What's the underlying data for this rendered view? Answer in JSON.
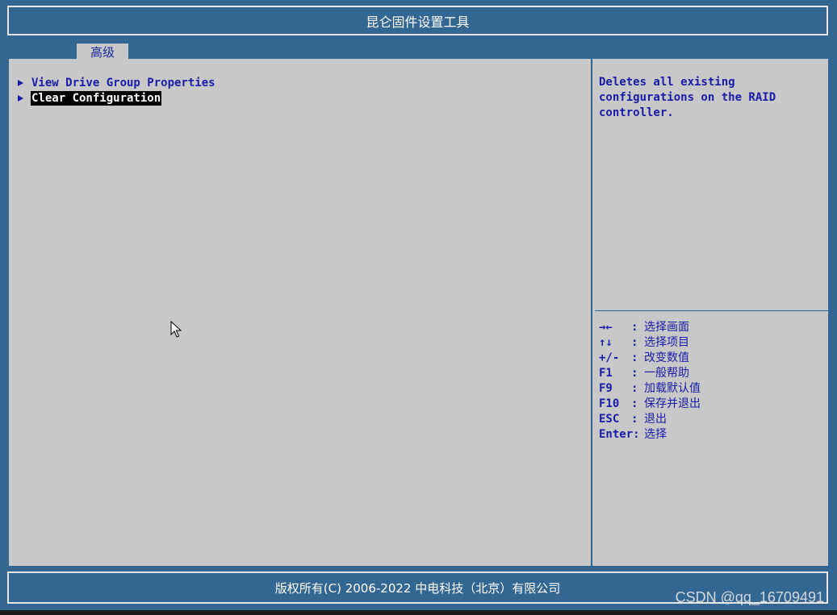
{
  "window": {
    "title": "昆仑固件设置工具"
  },
  "tabs": [
    {
      "label": "高级",
      "active": true
    }
  ],
  "menu": {
    "items": [
      {
        "label": "View Drive Group Properties",
        "selected": false
      },
      {
        "label": "Clear Configuration",
        "selected": true
      }
    ]
  },
  "help": {
    "text": "Deletes all existing\nconfigurations on the RAID\ncontroller."
  },
  "keys": [
    {
      "key": "→←",
      "sep": ":",
      "desc": "选择画面"
    },
    {
      "key": "↑↓",
      "sep": ":",
      "desc": "选择项目"
    },
    {
      "key": "+/-",
      "sep": ":",
      "desc": "改变数值"
    },
    {
      "key": "F1",
      "sep": ":",
      "desc": "一般帮助"
    },
    {
      "key": "F9",
      "sep": ":",
      "desc": "加载默认值"
    },
    {
      "key": "F10",
      "sep": ":",
      "desc": "保存并退出"
    },
    {
      "key": "ESC",
      "sep": ":",
      "desc": "退出"
    },
    {
      "key": "Enter:",
      "sep": "",
      "desc": "选择"
    }
  ],
  "footer": {
    "copyright": "版权所有(C) 2006-2022 中电科技（北京）有限公司"
  },
  "watermark": {
    "text": "CSDN @qq_16709491"
  },
  "colors": {
    "frame": "#336791",
    "panel": "#c8c8c8",
    "text": "#1a1aa8",
    "selection_bg": "#000000",
    "selection_fg": "#ffffff"
  },
  "icons": {
    "cursor": "mouse-pointer-icon",
    "item_marker": "triangle-right-icon"
  }
}
